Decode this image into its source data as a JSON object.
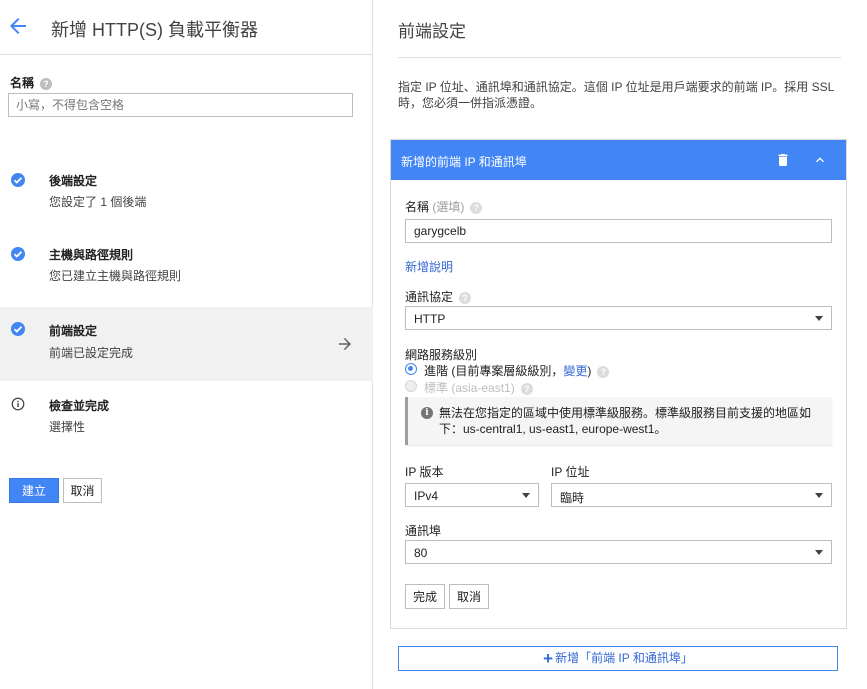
{
  "header": {
    "title": "新增 HTTP(S) 負載平衡器"
  },
  "name_field": {
    "label": "名稱",
    "placeholder": "小寫，不得包含空格"
  },
  "steps": [
    {
      "title": "後端設定",
      "subtitle": "您設定了 1 個後端",
      "status": "complete"
    },
    {
      "title": "主機與路徑規則",
      "subtitle": "您已建立主機與路徑規則",
      "status": "complete"
    },
    {
      "title": "前端設定",
      "subtitle": "前端已設定完成",
      "status": "complete"
    },
    {
      "title": "檢查並完成",
      "subtitle": "選擇性",
      "status": "info"
    }
  ],
  "actions": {
    "create_label": "建立",
    "cancel_label": "取消"
  },
  "frontend": {
    "title": "前端設定",
    "description": "指定 IP 位址、通訊埠和通訊協定。這個 IP 位址是用戶端要求的前端 IP。採用 SSL 時，您必須一併指派憑證。",
    "card": {
      "title": "新增的前端 IP 和通訊埠",
      "name_label": "名稱",
      "name_optional": "(選填)",
      "name_value": "garygcelb",
      "add_description": "新增說明",
      "protocol_label": "通訊協定",
      "protocol_value": "HTTP",
      "tier_label": "網路服務級別",
      "tier_premium_label": "進階 (目前專案層級級別，",
      "tier_premium_link": "變更",
      "tier_premium_close": ")",
      "tier_standard_label": "標準",
      "tier_standard_region": "(asia-east1)",
      "info_text": "無法在您指定的區域中使用標準級服務。標準級服務目前支援的地區如下：us-central1, us-east1, europe-west1。",
      "ip_version_label": "IP 版本",
      "ip_version_value": "IPv4",
      "ip_address_label": "IP 位址",
      "ip_address_value": "臨時",
      "port_label": "通訊埠",
      "port_value": "80",
      "done_label": "完成",
      "cancel_label": "取消"
    },
    "add_button_label": "新增「前端 IP 和通訊埠」"
  },
  "colors": {
    "primary": "#4285f4",
    "link": "#3367d6",
    "active_step_bg": "#f1f1f1"
  }
}
